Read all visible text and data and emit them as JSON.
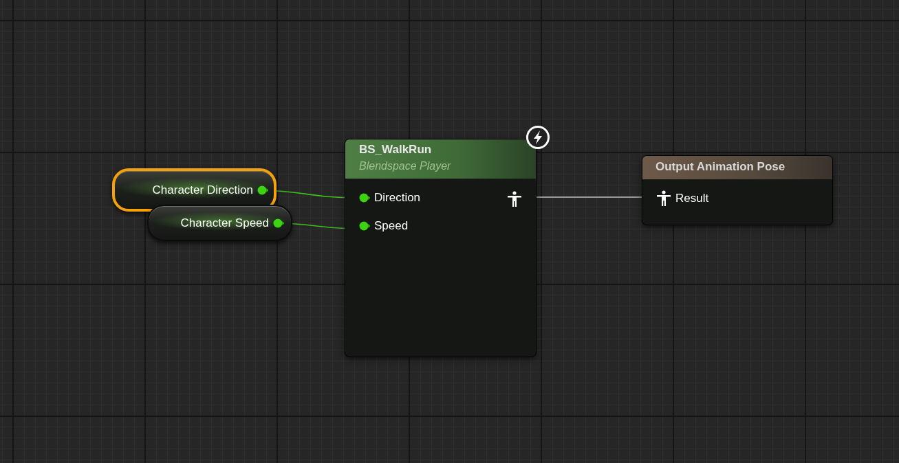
{
  "variables": [
    {
      "label": "Character Direction",
      "selected": true
    },
    {
      "label": "Character Speed",
      "selected": false
    }
  ],
  "blendspace_node": {
    "title": "BS_WalkRun",
    "subtitle": "Blendspace Player",
    "inputs": [
      "Direction",
      "Speed"
    ]
  },
  "output_node": {
    "title": "Output Animation Pose",
    "inputs": [
      "Result"
    ]
  }
}
